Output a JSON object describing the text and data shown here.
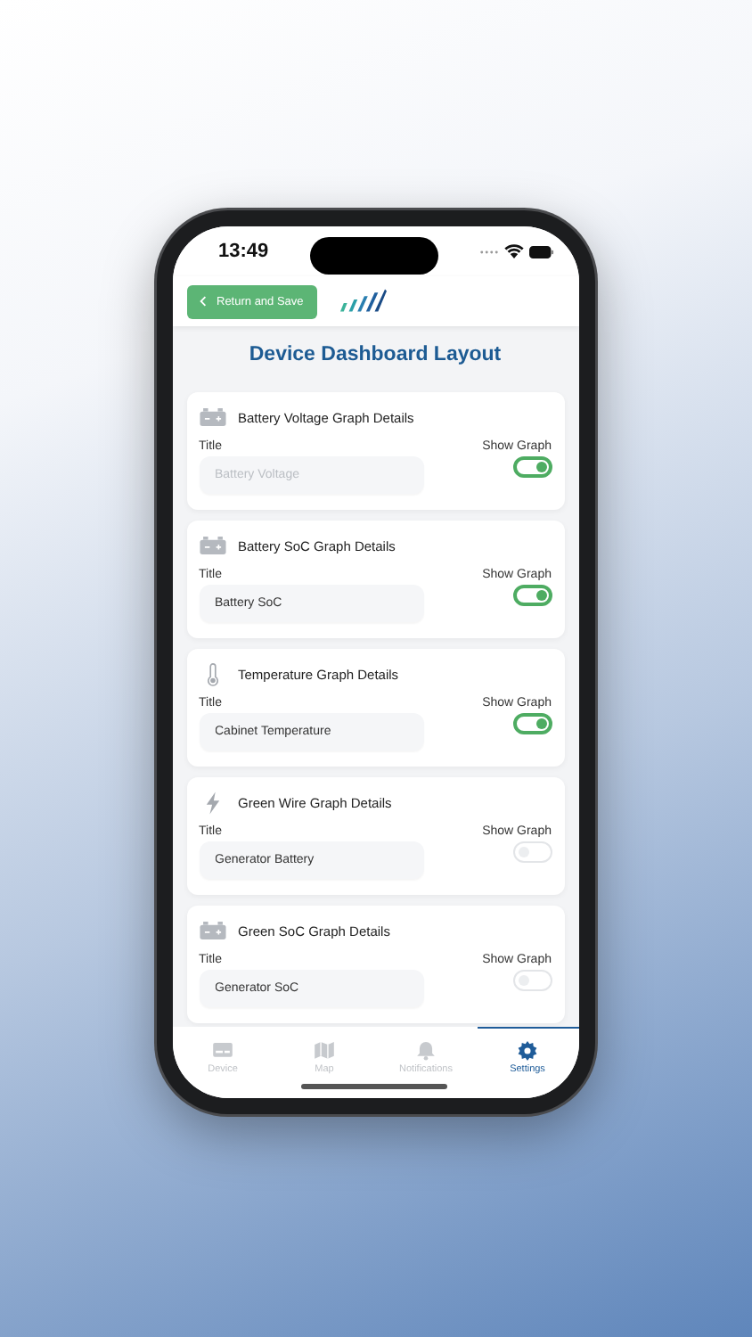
{
  "status_bar": {
    "time": "13:49"
  },
  "header": {
    "back_button": "Return and Save"
  },
  "page_title": "Device Dashboard Layout",
  "cards": [
    {
      "kind": "battery",
      "heading": "Battery Voltage Graph Details",
      "title_label": "Title",
      "title_field": {
        "placeholder": "Battery Voltage"
      },
      "toggle_label": "Show Graph",
      "on": true
    },
    {
      "kind": "battery",
      "heading": "Battery SoC Graph Details",
      "title_label": "Title",
      "title_field": {
        "value": "Battery SoC"
      },
      "toggle_label": "Show Graph",
      "on": true
    },
    {
      "kind": "temperature",
      "heading": "Temperature Graph Details",
      "title_label": "Title",
      "title_field": {
        "value": "Cabinet Temperature"
      },
      "toggle_label": "Show Graph",
      "on": true
    },
    {
      "kind": "power",
      "heading": "Green Wire Graph Details",
      "title_label": "Title",
      "title_field": {
        "value": "Generator Battery"
      },
      "toggle_label": "Show Graph",
      "on": false
    },
    {
      "kind": "battery",
      "heading": "Green SoC Graph Details",
      "title_label": "Title",
      "title_field": {
        "value": "Generator SoC"
      },
      "toggle_label": "Show Graph",
      "on": false
    }
  ],
  "tab_bar": [
    {
      "kind": "device",
      "label": "Device",
      "selected": false
    },
    {
      "kind": "map",
      "label": "Map",
      "selected": false
    },
    {
      "kind": "notifications",
      "label": "Notifications",
      "selected": false
    },
    {
      "kind": "settings",
      "label": "Settings",
      "selected": true
    }
  ]
}
